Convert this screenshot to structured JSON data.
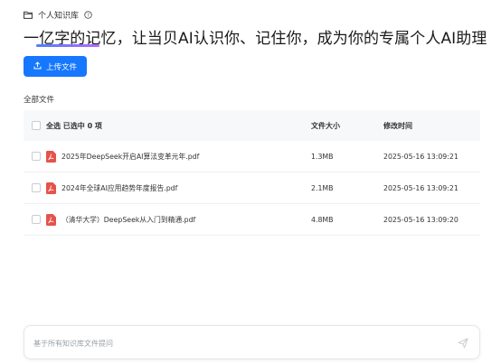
{
  "breadcrumb": {
    "title": "个人知识库",
    "icon": "folder-icon",
    "help_icon": "question-circle-icon"
  },
  "hero": {
    "highlight": "一亿字的记忆",
    "rest": "，让当贝AI认识你、记住你，成为你的专属个人AI助理"
  },
  "toolbar": {
    "upload_label": "上传文件",
    "upload_icon": "upload-icon"
  },
  "section": {
    "title": "全部文件"
  },
  "table": {
    "select_all_label": "全选 已选中 0 项",
    "columns": {
      "size": "文件大小",
      "time": "修改时间"
    },
    "rows": [
      {
        "name": "2025年DeepSeek开启AI算法变革元年.pdf",
        "size": "1.3MB",
        "time": "2025-05-16 13:09:21"
      },
      {
        "name": "2024年全球AI应用趋势年度报告.pdf",
        "size": "2.1MB",
        "time": "2025-05-16 13:09:21"
      },
      {
        "name": "（清华大学）DeepSeek从入门到精通.pdf",
        "size": "4.8MB",
        "time": "2025-05-16 13:09:20"
      }
    ]
  },
  "chat": {
    "placeholder": "基于所有知识库文件提问",
    "send_icon": "send-icon"
  },
  "colors": {
    "primary": "#1677ff",
    "pdf_red": "#e5534b",
    "underline_start": "#4f7cff",
    "underline_end": "#b06cff"
  }
}
